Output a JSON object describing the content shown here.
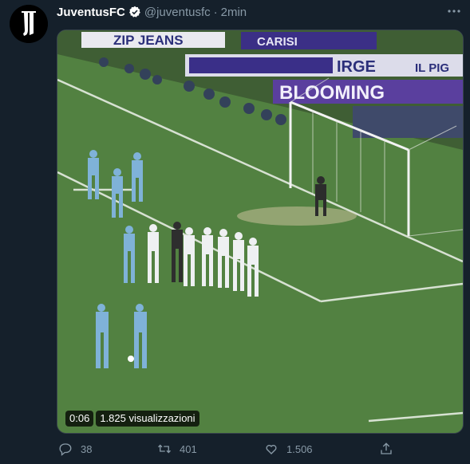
{
  "tweet": {
    "display_name": "JuventusFC",
    "handle": "@juventusfc",
    "separator": "·",
    "time": "2min",
    "avatar_icon": "juventus-logo-icon",
    "verified_icon": "verified-badge-icon",
    "more_icon": "more-horizontal-icon"
  },
  "media": {
    "type": "video",
    "elapsed": "0:06",
    "views": "1.825 visualizzazioni",
    "billboards": [
      "ZIP JEANS",
      "CARISI",
      "IRGE",
      "IL PIG",
      "BLOOMING"
    ]
  },
  "actions": {
    "reply": {
      "icon": "reply-icon",
      "count": "38"
    },
    "retweet": {
      "icon": "retweet-icon",
      "count": "401"
    },
    "like": {
      "icon": "heart-icon",
      "count": "1.506"
    },
    "share": {
      "icon": "share-icon"
    }
  },
  "colors": {
    "background": "#15202b",
    "secondary_text": "#8899a6",
    "verified": "#ffffff",
    "pitch": "#4d7a3c"
  }
}
